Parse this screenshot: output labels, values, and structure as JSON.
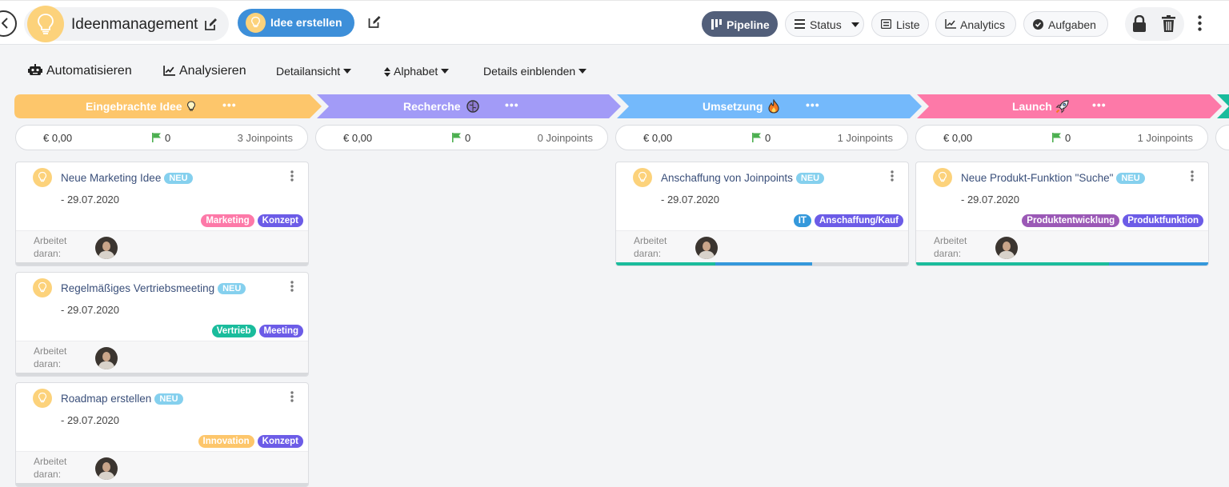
{
  "header": {
    "title": "Ideenmanagement",
    "create_button": "Idee erstellen",
    "nav": {
      "pipeline": "Pipeline",
      "status": "Status",
      "liste": "Liste",
      "analytics": "Analytics",
      "aufgaben": "Aufgaben"
    }
  },
  "toolbar": {
    "automate": "Automatisieren",
    "analyse": "Analysieren",
    "detail_view": "Detailansicht",
    "sort": "Alphabet",
    "show_details": "Details einblenden"
  },
  "stages": [
    {
      "label": "Eingebrachte Idee",
      "icon": "lightbulb-icon",
      "color": "#fdc66b",
      "money": "€ 0,00",
      "flags": "0",
      "joinpoints": "3 Joinpoints"
    },
    {
      "label": "Recherche",
      "icon": "brain-icon",
      "color": "#a29bf7",
      "money": "€ 0,00",
      "flags": "0",
      "joinpoints": "0 Joinpoints"
    },
    {
      "label": "Umsetzung",
      "icon": "fire-icon",
      "color": "#74b9fb",
      "money": "€ 0,00",
      "flags": "0",
      "joinpoints": "1 Joinpoints"
    },
    {
      "label": "Launch",
      "icon": "rocket-icon",
      "color": "#fd79a8",
      "money": "€ 0,00",
      "flags": "0",
      "joinpoints": "1 Joinpoints"
    }
  ],
  "card_common": {
    "badge": "NEU",
    "worked_on": "Arbeitet daran:"
  },
  "cards": [
    {
      "title": "Neue Marketing Idee",
      "date": "- 29.07.2020",
      "tags": [
        {
          "label": "Marketing",
          "color": "#fd79a8"
        },
        {
          "label": "Konzept",
          "color": "#6c5ce7"
        }
      ],
      "progress": [
        {
          "color": "#d8dadd",
          "fraction": 1.0
        }
      ]
    },
    {
      "title": "Regelmäßiges Vertriebsmeeting",
      "date": "- 29.07.2020",
      "tags": [
        {
          "label": "Vertrieb",
          "color": "#1abc9c"
        },
        {
          "label": "Meeting",
          "color": "#6c5ce7"
        }
      ],
      "progress": [
        {
          "color": "#d8dadd",
          "fraction": 1.0
        }
      ]
    },
    {
      "title": "Roadmap erstellen",
      "date": "- 29.07.2020",
      "tags": [
        {
          "label": "Innovation",
          "color": "#fdc66b"
        },
        {
          "label": "Konzept",
          "color": "#6c5ce7"
        }
      ],
      "progress": [
        {
          "color": "#d8dadd",
          "fraction": 1.0
        }
      ]
    },
    {
      "title": "Anschaffung von Joinpoints",
      "date": "- 29.07.2020",
      "tags": [
        {
          "label": "IT",
          "color": "#3498db"
        },
        {
          "label": "Anschaffung/Kauf",
          "color": "#6c5ce7"
        }
      ],
      "progress": [
        {
          "color": "#1abc9c",
          "fraction": 0.34
        },
        {
          "color": "#3498db",
          "fraction": 0.33
        }
      ]
    },
    {
      "title": "Neue Produkt-Funktion \"Suche\"",
      "date": "- 29.07.2020",
      "tags": [
        {
          "label": "Produktentwicklung",
          "color": "#9b59b6"
        },
        {
          "label": "Produktfunktion",
          "color": "#6c5ce7"
        }
      ],
      "progress": [
        {
          "color": "#1abc9c",
          "fraction": 0.66
        },
        {
          "color": "#3498db",
          "fraction": 0.34
        }
      ]
    }
  ]
}
